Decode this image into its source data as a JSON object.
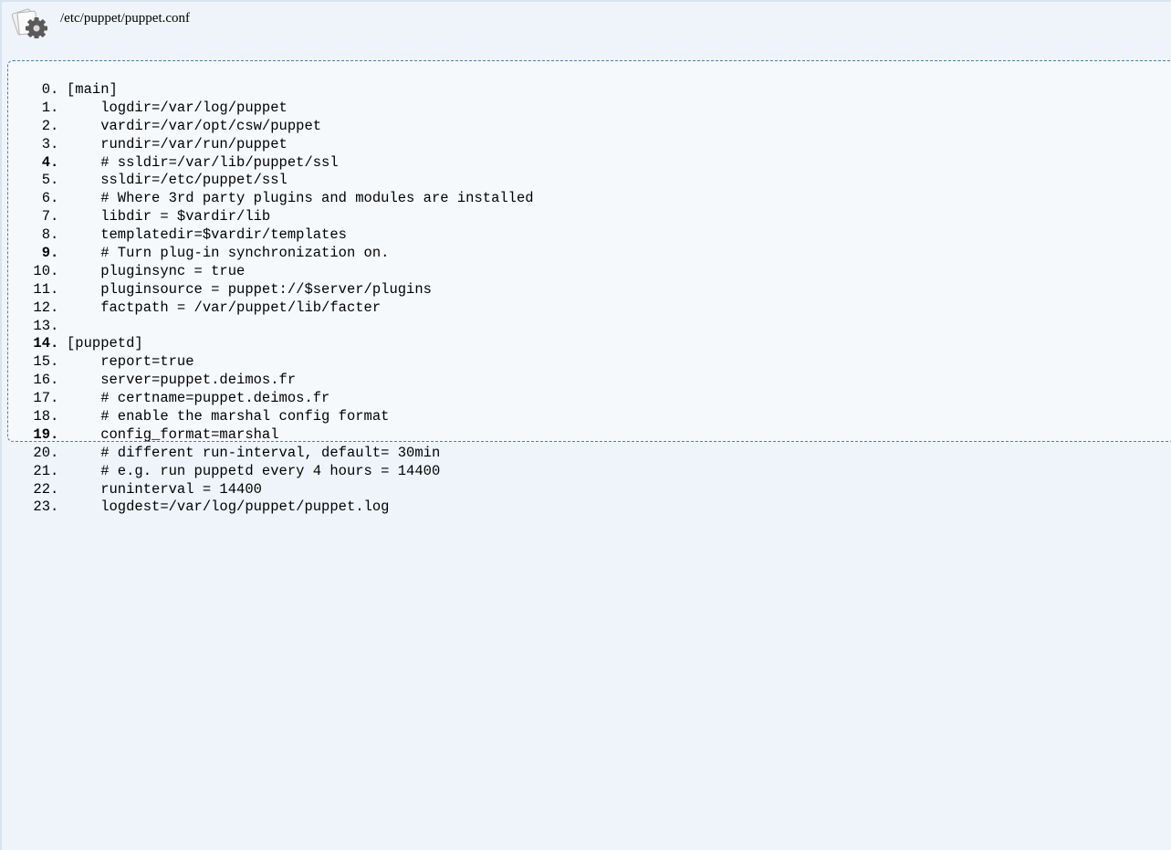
{
  "file_header": {
    "icon": "settings-file-icon",
    "path": "/etc/puppet/puppet.conf"
  },
  "code": {
    "lines": [
      {
        "num": "0",
        "bold": false,
        "text": "[main]"
      },
      {
        "num": "1",
        "bold": false,
        "text": "    logdir=/var/log/puppet"
      },
      {
        "num": "2",
        "bold": false,
        "text": "    vardir=/var/opt/csw/puppet"
      },
      {
        "num": "3",
        "bold": false,
        "text": "    rundir=/var/run/puppet"
      },
      {
        "num": "4",
        "bold": true,
        "text": "    # ssldir=/var/lib/puppet/ssl"
      },
      {
        "num": "5",
        "bold": false,
        "text": "    ssldir=/etc/puppet/ssl"
      },
      {
        "num": "6",
        "bold": false,
        "text": "    # Where 3rd party plugins and modules are installed"
      },
      {
        "num": "7",
        "bold": false,
        "text": "    libdir = $vardir/lib"
      },
      {
        "num": "8",
        "bold": false,
        "text": "    templatedir=$vardir/templates"
      },
      {
        "num": "9",
        "bold": true,
        "text": "    # Turn plug-in synchronization on."
      },
      {
        "num": "10",
        "bold": false,
        "text": "    pluginsync = true"
      },
      {
        "num": "11",
        "bold": false,
        "text": "    pluginsource = puppet://$server/plugins"
      },
      {
        "num": "12",
        "bold": false,
        "text": "    factpath = /var/puppet/lib/facter"
      },
      {
        "num": "13",
        "bold": false,
        "text": ""
      },
      {
        "num": "14",
        "bold": true,
        "text": "[puppetd]"
      },
      {
        "num": "15",
        "bold": false,
        "text": "    report=true"
      },
      {
        "num": "16",
        "bold": false,
        "text": "    server=puppet.deimos.fr"
      },
      {
        "num": "17",
        "bold": false,
        "text": "    # certname=puppet.deimos.fr"
      },
      {
        "num": "18",
        "bold": false,
        "text": "    # enable the marshal config format"
      },
      {
        "num": "19",
        "bold": true,
        "text": "    config_format=marshal"
      },
      {
        "num": "20",
        "bold": false,
        "text": "    # different run-interval, default= 30min"
      },
      {
        "num": "21",
        "bold": false,
        "text": "    # e.g. run puppetd every 4 hours = 14400"
      },
      {
        "num": "22",
        "bold": false,
        "text": "    runinterval = 14400"
      },
      {
        "num": "23",
        "bold": false,
        "text": "    logdest=/var/log/puppet/puppet.log"
      }
    ]
  }
}
